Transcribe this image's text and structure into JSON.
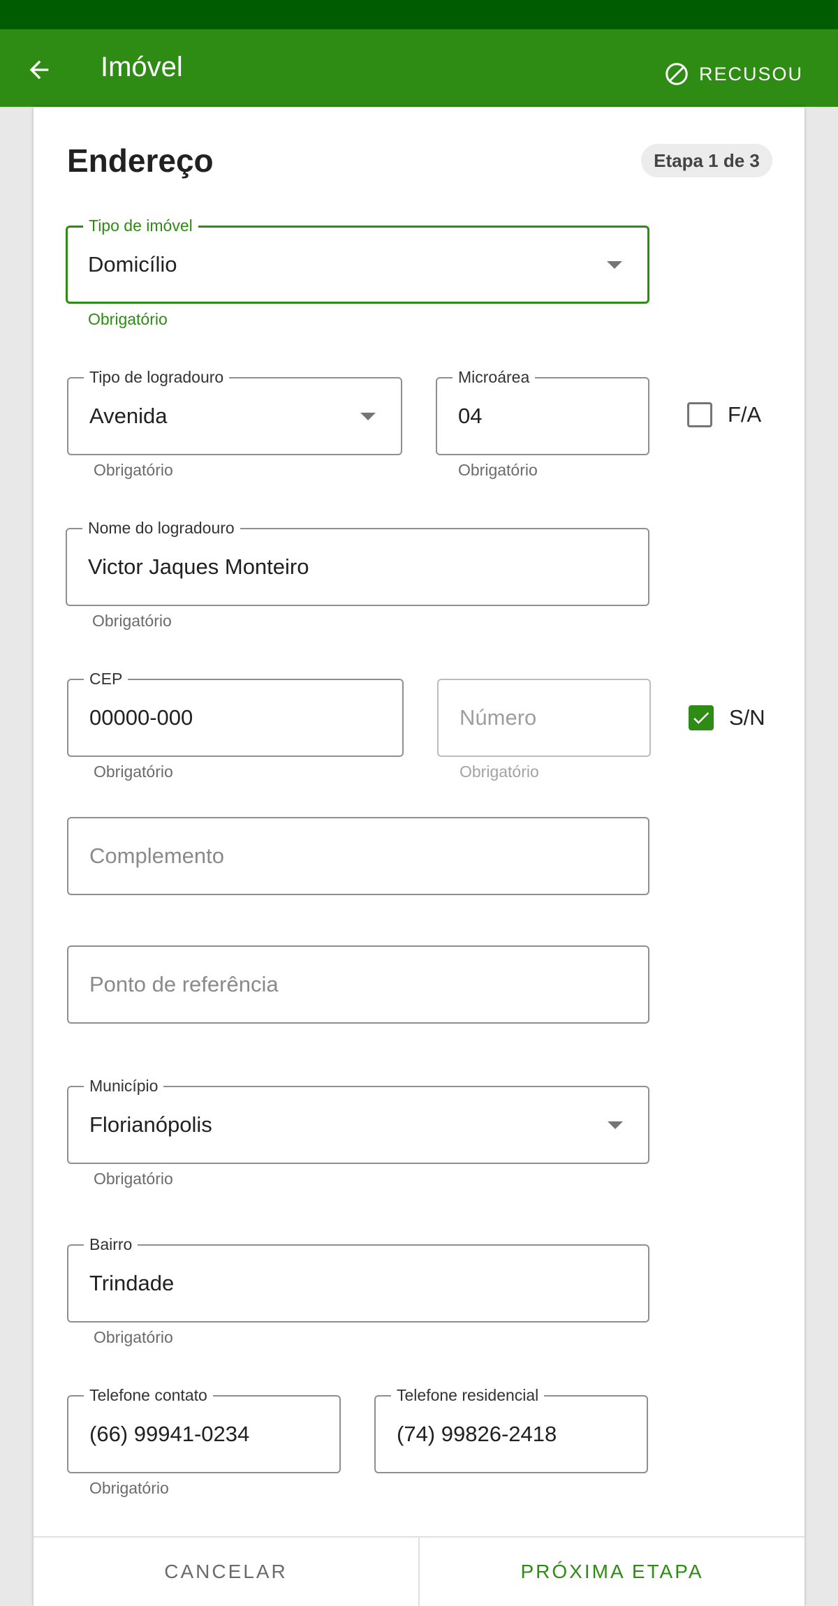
{
  "appbar": {
    "title": "Imóvel",
    "refused_label": "RECUSOU"
  },
  "form": {
    "section_title": "Endereço",
    "step_badge": "Etapa 1 de 3",
    "property_type": {
      "label": "Tipo de imóvel",
      "value": "Domicílio",
      "helper": "Obrigatório"
    },
    "street_type": {
      "label": "Tipo de logradouro",
      "value": "Avenida",
      "helper": "Obrigatório"
    },
    "micro_area": {
      "label": "Microárea",
      "value": "04",
      "helper": "Obrigatório"
    },
    "fa_checkbox": {
      "label": "F/A",
      "checked": false
    },
    "street_name": {
      "label": "Nome do logradouro",
      "value": "Victor Jaques Monteiro",
      "helper": "Obrigatório"
    },
    "cep": {
      "label": "CEP",
      "value": "00000-000",
      "helper": "Obrigatório"
    },
    "number": {
      "placeholder": "Número",
      "helper": "Obrigatório"
    },
    "sn_checkbox": {
      "label": "S/N",
      "checked": true
    },
    "complement": {
      "placeholder": "Complemento"
    },
    "reference_point": {
      "placeholder": "Ponto de referência"
    },
    "municipality": {
      "label": "Município",
      "value": "Florianópolis",
      "helper": "Obrigatório"
    },
    "neighborhood": {
      "label": "Bairro",
      "value": "Trindade",
      "helper": "Obrigatório"
    },
    "contact_phone": {
      "label": "Telefone contato",
      "value": "(66) 99941-0234",
      "helper": "Obrigatório"
    },
    "home_phone": {
      "label": "Telefone residencial",
      "value": "(74) 99826-2418"
    }
  },
  "footer": {
    "cancel_label": "CANCELAR",
    "next_label": "PRÓXIMA ETAPA"
  },
  "colors": {
    "primary": "#2e8b14",
    "status_bar": "#005c00"
  }
}
